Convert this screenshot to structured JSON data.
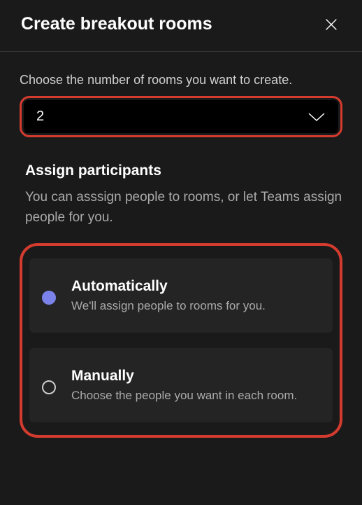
{
  "header": {
    "title": "Create breakout rooms"
  },
  "rooms": {
    "choose_label": "Choose the number of rooms you want to create.",
    "selected_value": "2"
  },
  "assign": {
    "title": "Assign participants",
    "description": "You can asssign people to rooms, or let Teams assign people for you.",
    "options": [
      {
        "title": "Automatically",
        "description": "We'll assign people to rooms for you.",
        "selected": true
      },
      {
        "title": "Manually",
        "description": "Choose the people you want in each room.",
        "selected": false
      }
    ]
  }
}
